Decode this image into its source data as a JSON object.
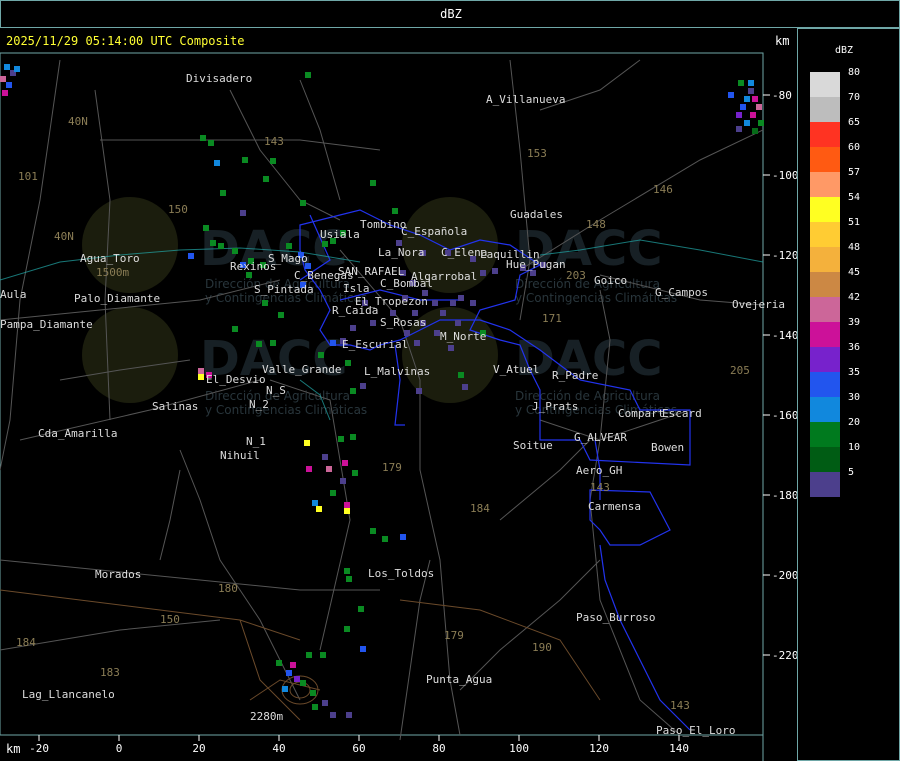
{
  "window": {
    "title": "dBZ",
    "header": "2025/11/29 05:14:00 UTC Composite",
    "unit_top": "km",
    "unit_bottom": "km"
  },
  "x_axis_ticks": [
    "-20",
    "0",
    "20",
    "40",
    "60",
    "80",
    "100",
    "120",
    "140"
  ],
  "y_axis_ticks": [
    "-80",
    "-100",
    "-120",
    "-140",
    "-160",
    "-180",
    "-200",
    "-220"
  ],
  "legend": {
    "title": "dBZ",
    "items": [
      {
        "label": "80",
        "color": "#d9d9d9"
      },
      {
        "label": "70",
        "color": "#bdbdbd"
      },
      {
        "label": "65",
        "color": "#ff3322"
      },
      {
        "label": "60",
        "color": "#ff5a12"
      },
      {
        "label": "57",
        "color": "#ff9966"
      },
      {
        "label": "54",
        "color": "#ffff22"
      },
      {
        "label": "51",
        "color": "#ffcc33"
      },
      {
        "label": "48",
        "color": "#f4b13c"
      },
      {
        "label": "45",
        "color": "#cc8844"
      },
      {
        "label": "42",
        "color": "#cc6699"
      },
      {
        "label": "39",
        "color": "#cc1199"
      },
      {
        "label": "36",
        "color": "#7722cc"
      },
      {
        "label": "35",
        "color": "#2255ee"
      },
      {
        "label": "30",
        "color": "#1188dd"
      },
      {
        "label": "20",
        "color": "#007a1e"
      },
      {
        "label": "10",
        "color": "#005c14"
      },
      {
        "label": "5",
        "color": "#4c3f8c"
      }
    ]
  },
  "places": [
    "Divisadero",
    "A_Villanueva",
    "40N",
    "101",
    "150",
    "143",
    "153",
    "146",
    "Guadales",
    "148",
    "40N",
    "Agua_Toro",
    "Rexinos",
    "S_Mago",
    "Usiala",
    "Tombino",
    "C_Española",
    "La_Nora",
    "C_Elena",
    "Laquillin",
    "Hue_Pugan",
    "C_Benegas",
    "SAN_RAFAEL",
    "Algarrobal",
    "C_Bombal",
    "Goico",
    "G_Campos",
    "Ovejeria",
    "S_Pintada",
    "Isla",
    "El_Tropezon",
    "R_Caida",
    "S_Rosas",
    "Pampa_Diamante",
    "Aula",
    "Palo_Diamante",
    "E_Escurial",
    "M_Norte",
    "El_Desvio",
    "Valle_Grande",
    "L_Malvinas",
    "V_Atuel",
    "R_Padre",
    "Salinas",
    "N_S",
    "N_2",
    "J_Prats",
    "Compart",
    "Escard",
    "Cda_Amarilla",
    "G_ALVEAR",
    "N_1",
    "Nihuil",
    "Soitue",
    "Bowen",
    "Aero_GH",
    "Carmensa",
    "Morados",
    "Los_Toldos",
    "Paso_Burroso",
    "Punta_Agua",
    "Lag_Llancanelo",
    "Paso_El_Loro",
    "184",
    "183",
    "180",
    "179",
    "150",
    "179",
    "184",
    "190",
    "143",
    "2280m",
    "1500m",
    "205",
    "143",
    "171",
    "203"
  ],
  "watermark": {
    "brand": "DACC",
    "line1": "Dirección de Agricultura",
    "line2": "y Contingencias Climáticas"
  }
}
